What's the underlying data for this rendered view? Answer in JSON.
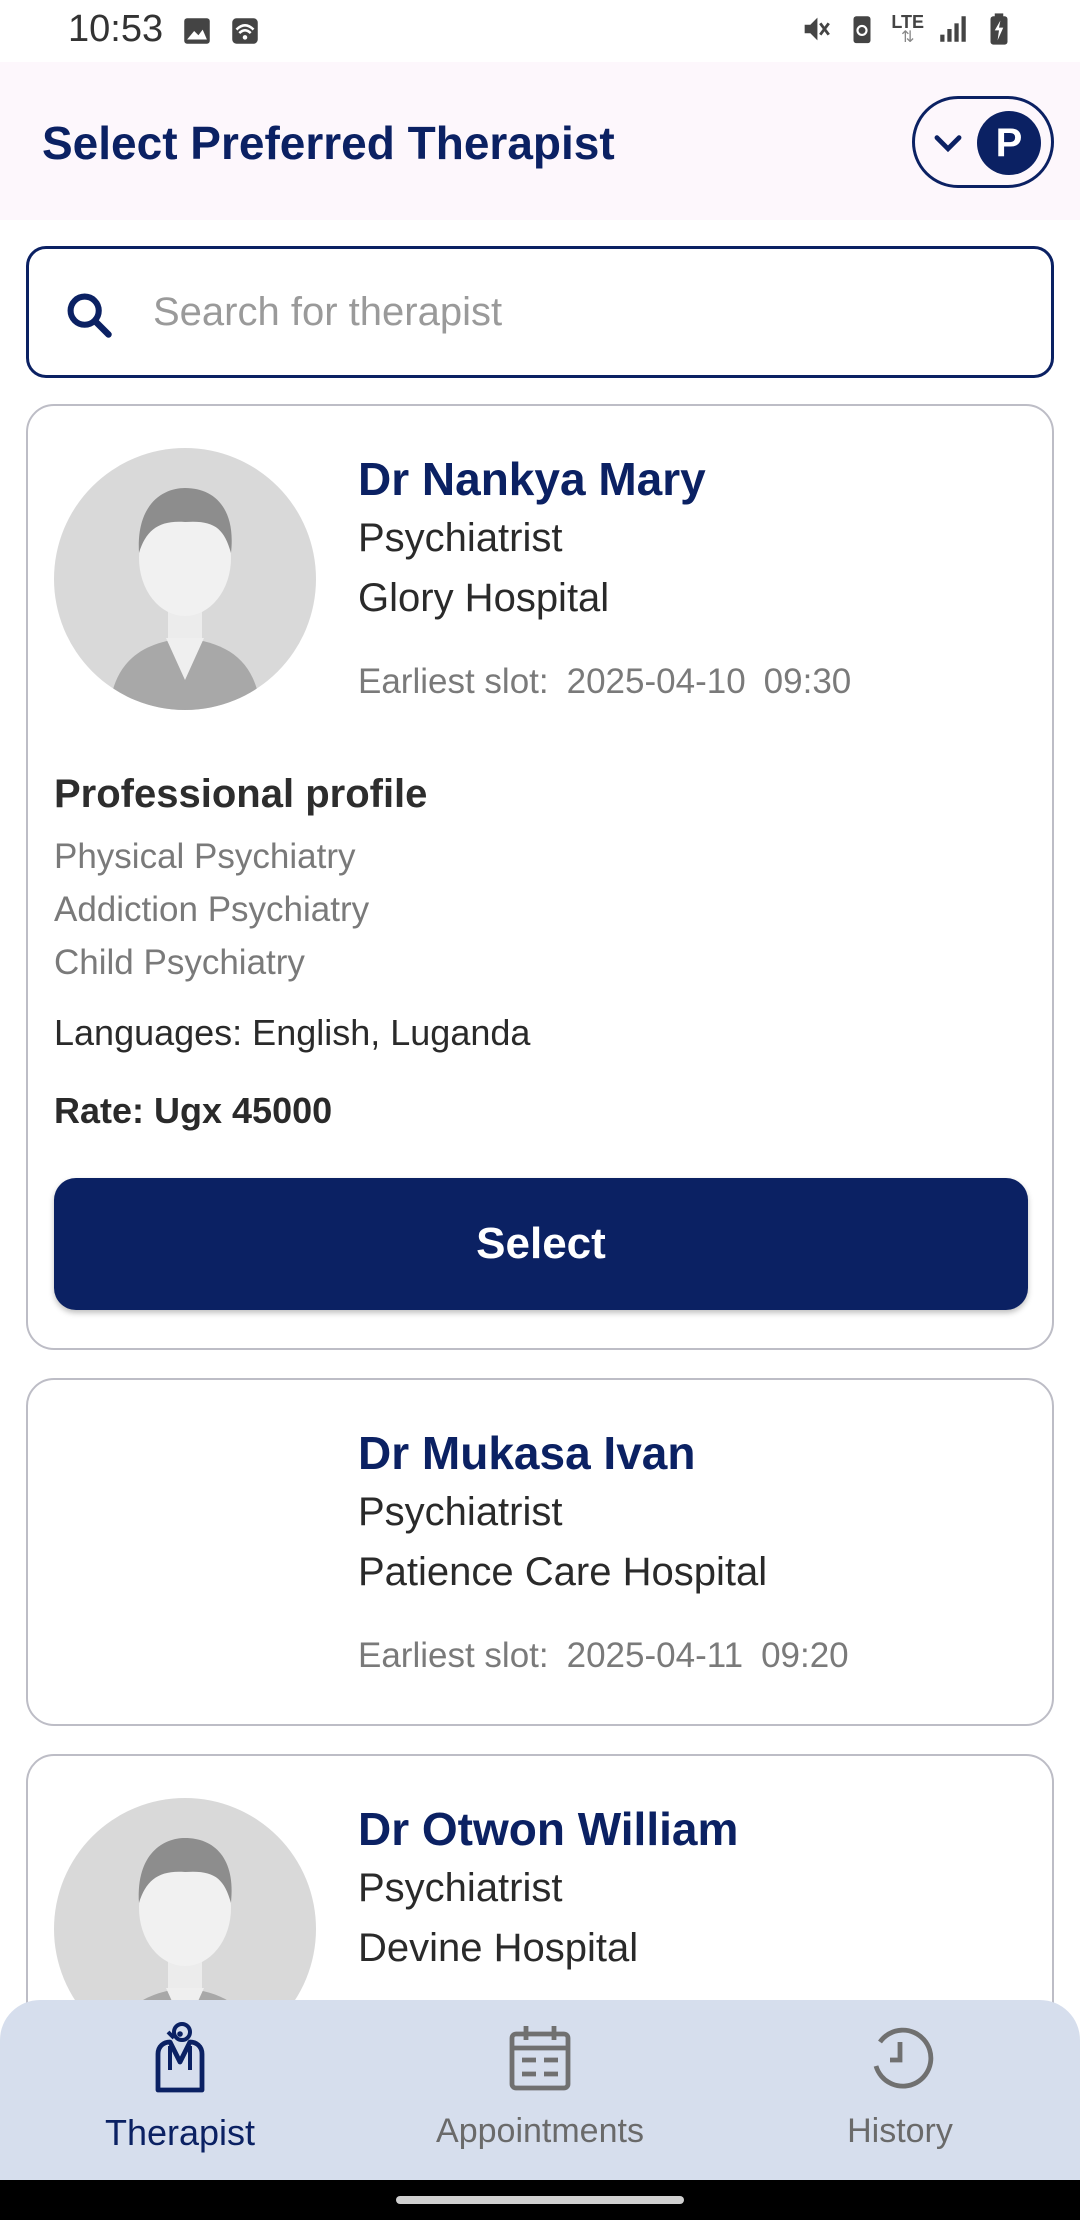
{
  "status_bar": {
    "time": "10:53",
    "left_icons": [
      "image-icon",
      "wifi-calling-icon"
    ],
    "right_icons": [
      "vibrate-mute-icon",
      "data-saver-icon",
      "lte-icon",
      "signal-icon",
      "battery-charging-icon"
    ],
    "network_label": "LTE"
  },
  "header": {
    "title": "Select Preferred Therapist",
    "profile_initial": "P"
  },
  "search": {
    "placeholder": "Search for therapist",
    "value": ""
  },
  "therapists": [
    {
      "name": "Dr Nankya Mary",
      "role": "Psychiatrist",
      "hospital": "Glory Hospital",
      "slot_label": "Earliest slot:",
      "slot_date": "2025-04-10",
      "slot_time": "09:30",
      "has_photo": true,
      "profile_title": "Professional profile",
      "specialties": [
        "Physical Psychiatry",
        "Addiction Psychiatry",
        "Child Psychiatry"
      ],
      "languages": "Languages: English, Luganda",
      "rate": "Rate: Ugx 45000",
      "select_label": "Select"
    },
    {
      "name": "Dr Mukasa Ivan",
      "role": "Psychiatrist",
      "hospital": "Patience Care Hospital",
      "slot_label": "Earliest slot:",
      "slot_date": "2025-04-11",
      "slot_time": "09:20",
      "has_photo": false
    },
    {
      "name": "Dr Otwon William",
      "role": "Psychiatrist",
      "hospital": "Devine Hospital",
      "has_photo": true
    }
  ],
  "bottom_nav": {
    "items": [
      {
        "label": "Therapist",
        "icon": "therapist-icon",
        "active": true
      },
      {
        "label": "Appointments",
        "icon": "calendar-icon",
        "active": false
      },
      {
        "label": "History",
        "icon": "history-clock-icon",
        "active": false
      }
    ]
  },
  "colors": {
    "primary": "#0b2163",
    "header_bg": "#fdf7fc",
    "nav_bg": "#d6deed",
    "muted_text": "#7a7a7a"
  }
}
